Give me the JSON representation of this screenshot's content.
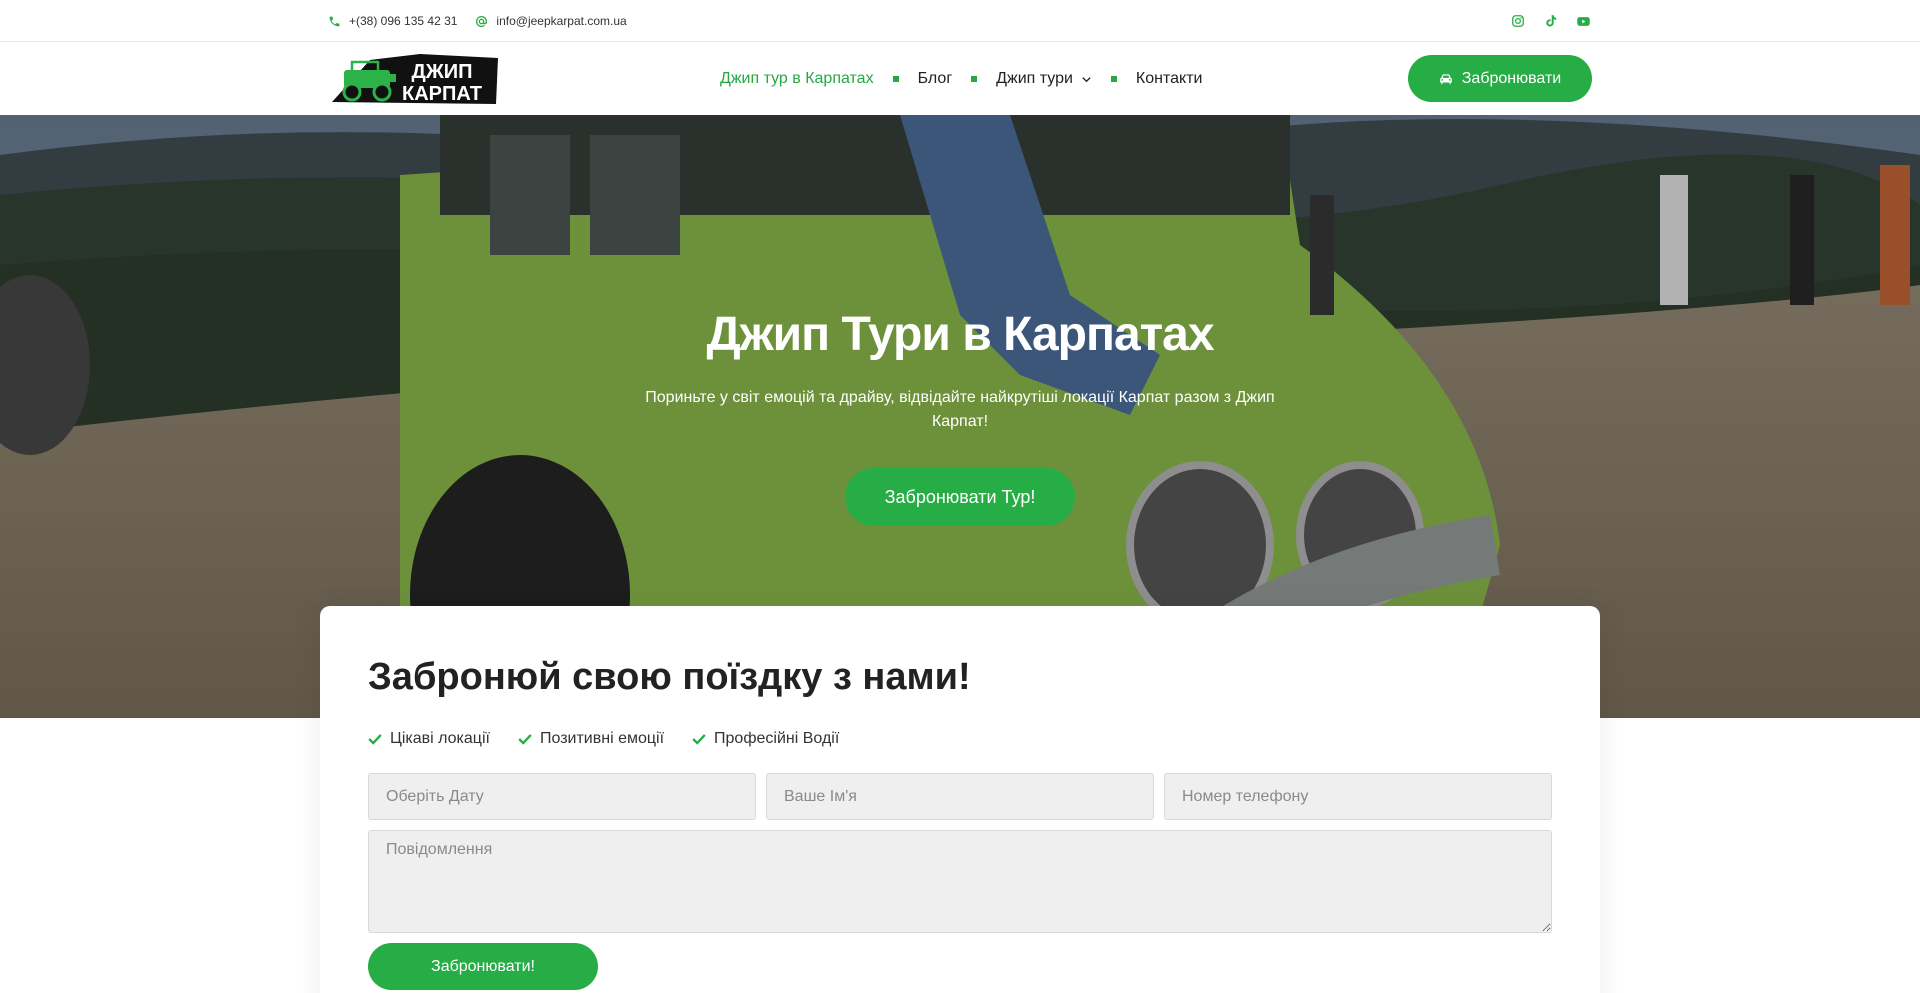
{
  "topbar": {
    "phone": "+(38) 096 135 42 31",
    "email": "info@jeepkarpat.com.ua",
    "socials": [
      "instagram-icon",
      "tiktok-icon",
      "youtube-icon"
    ]
  },
  "header": {
    "logo_line1": "ДЖИП",
    "logo_line2": "КАРПАТ",
    "nav": {
      "item1": "Джип тур в Карпатах",
      "item2": "Блог",
      "item3": "Джип тури",
      "item4": "Контакти"
    },
    "book_label": "Забронювати"
  },
  "hero": {
    "title": "Джип Тури в Карпатах",
    "subtitle": "Пориньте у світ емоцій та драйву, відвідайте найкрутіші локації Карпат разом з Джип Карпат!",
    "button": "Забронювати Тур!"
  },
  "booking": {
    "title": "Забронюй свою поїздку з нами!",
    "features": [
      "Цікаві локації",
      "Позитивні емоції",
      "Професійні Водії"
    ],
    "date_placeholder": "Оберіть Дату",
    "name_placeholder": "Ваше Ім'я",
    "phone_placeholder": "Номер телефону",
    "message_placeholder": "Повідомлення",
    "submit": "Забронювати!"
  },
  "colors": {
    "accent": "#27ad45",
    "text": "#222222",
    "field_bg": "#efefef"
  }
}
